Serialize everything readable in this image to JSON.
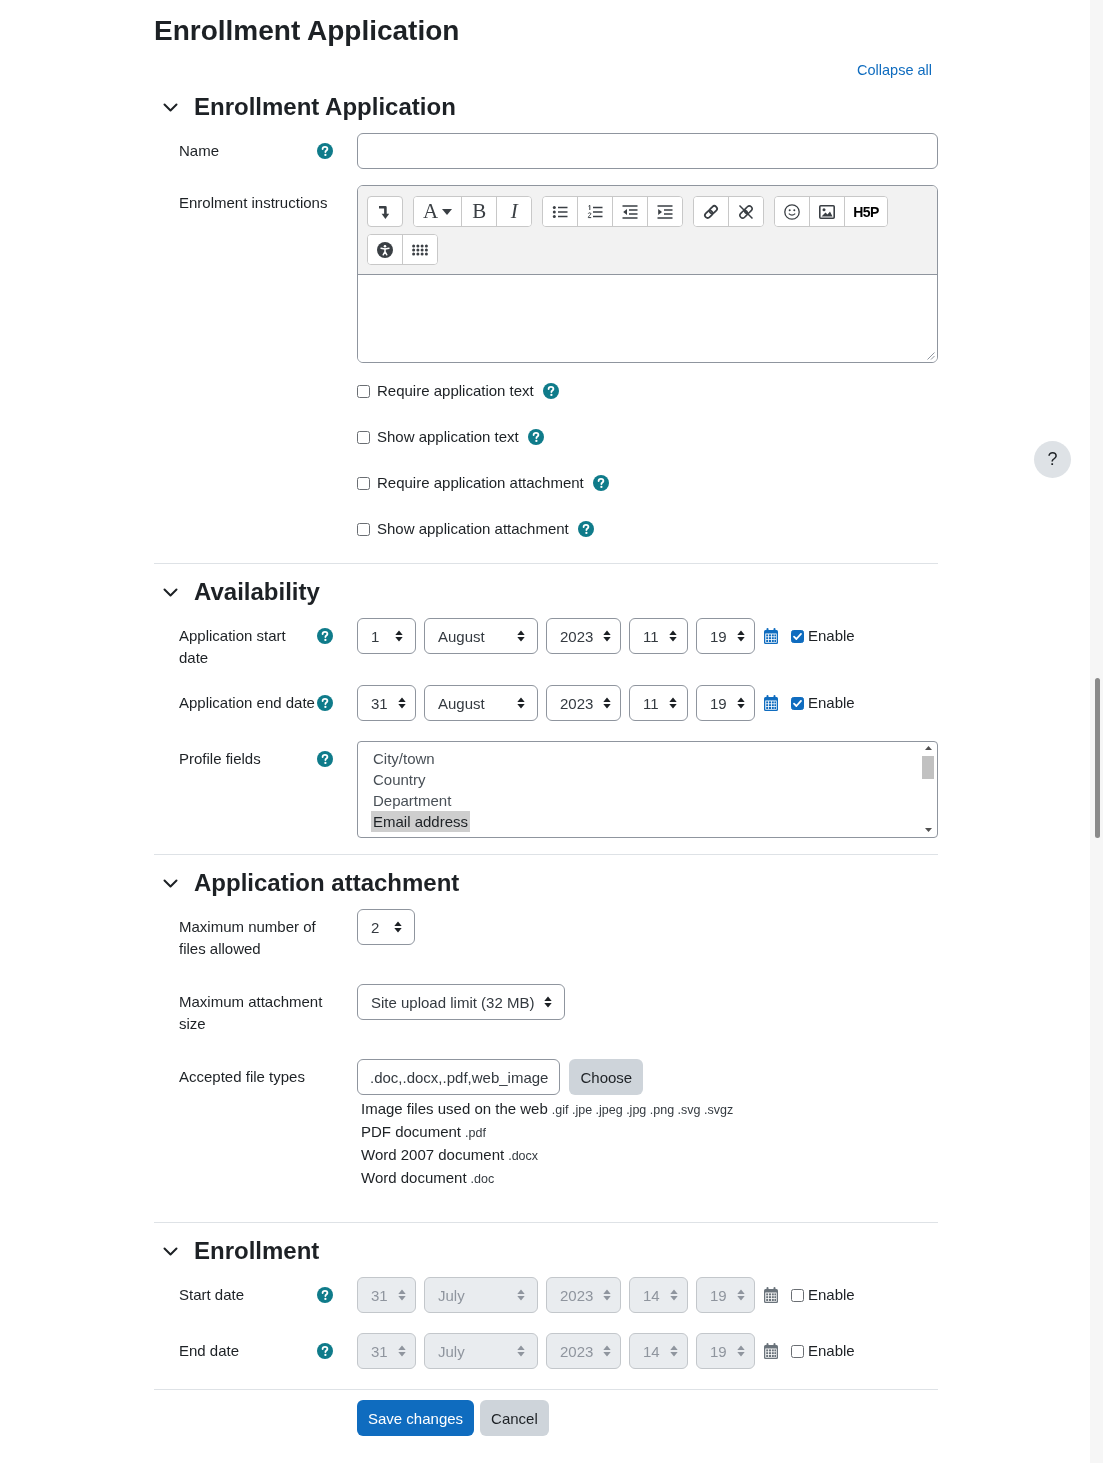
{
  "page_title": "Enrollment Application",
  "collapse_link": "Collapse all",
  "sections": [
    {
      "title": "Enrollment Application",
      "expanded": true,
      "rows": [
        {
          "kind": "text",
          "label": "Name",
          "help": true
        },
        {
          "kind": "editor",
          "label": "Enrolment instructions",
          "help": false,
          "toolbar": [
            [
              [
                {
                  "kind": "icon"
                }
              ],
              [
                {
                  "kind": "menu",
                  "label": "A"
                },
                {
                  "kind": "bold",
                  "label": "B"
                },
                {
                  "kind": "italic",
                  "label": "I"
                }
              ],
              [
                {
                  "kind": "icon"
                },
                {
                  "kind": "icon"
                },
                {
                  "kind": "icon"
                },
                {
                  "kind": "icon"
                }
              ],
              [
                {
                  "kind": "icon"
                },
                {
                  "kind": "icon"
                }
              ],
              [
                {
                  "kind": "icon"
                },
                {
                  "kind": "icon"
                },
                {
                  "kind": "logo",
                  "label": "H5P"
                }
              ]
            ],
            [
              [
                {
                  "kind": "icon"
                },
                {
                  "kind": "icon"
                }
              ]
            ]
          ]
        },
        {
          "kind": "checkbox",
          "label": "Require application text",
          "checked": false,
          "help": true
        },
        {
          "kind": "checkbox",
          "label": "Show application text",
          "checked": false,
          "help": true
        },
        {
          "kind": "checkbox",
          "label": "Require application attachment",
          "checked": false,
          "help": true
        },
        {
          "kind": "checkbox",
          "label": "Show application attachment",
          "checked": false,
          "help": true
        }
      ]
    },
    {
      "title": "Availability",
      "expanded": true,
      "rows": [
        {
          "kind": "date",
          "label": "Application start date",
          "help": true,
          "parts": [
            "1",
            "August",
            "2023",
            "11",
            "19"
          ],
          "enable_label": "Enable",
          "enabled": true
        },
        {
          "kind": "date",
          "label": "Application end date",
          "help": true,
          "parts": [
            "31",
            "August",
            "2023",
            "11",
            "19"
          ],
          "enable_label": "Enable",
          "enabled": true
        },
        {
          "kind": "listbox",
          "label": "Profile fields",
          "help": true,
          "options": [
            {
              "label": "City/town",
              "selected": false
            },
            {
              "label": "Country",
              "selected": false
            },
            {
              "label": "Department",
              "selected": false
            },
            {
              "label": "Email address",
              "selected": true
            }
          ]
        }
      ]
    },
    {
      "title": "Application attachment",
      "expanded": true,
      "rows": [
        {
          "kind": "select",
          "label": "Maximum number of files allowed",
          "help": false,
          "value": "2"
        },
        {
          "kind": "select",
          "label": "Maximum attachment size",
          "help": false,
          "value": "Site upload limit (32 MB)"
        },
        {
          "kind": "filetypes",
          "label": "Accepted file types",
          "help": false,
          "value": ".doc,.docx,.pdf,web_image",
          "button": "Choose",
          "types": [
            {
              "name": "Image files used on the web",
              "extensions": ".gif .jpe .jpeg .jpg .png .svg .svgz"
            },
            {
              "name": "PDF document",
              "extensions": ".pdf"
            },
            {
              "name": "Word 2007 document",
              "extensions": ".docx"
            },
            {
              "name": "Word document",
              "extensions": ".doc"
            }
          ]
        }
      ]
    },
    {
      "title": "Enrollment",
      "expanded": true,
      "rows": [
        {
          "kind": "date",
          "label": "Start date",
          "help": true,
          "parts": [
            "31",
            "July",
            "2023",
            "14",
            "19"
          ],
          "enable_label": "Enable",
          "enabled": false
        },
        {
          "kind": "date",
          "label": "End date",
          "help": true,
          "parts": [
            "31",
            "July",
            "2023",
            "14",
            "19"
          ],
          "enable_label": "Enable",
          "enabled": false
        }
      ]
    }
  ],
  "buttons": [
    {
      "label": "Save changes",
      "kind": "primary"
    },
    {
      "label": "Cancel",
      "kind": "secondary"
    }
  ],
  "help_button": {
    "label": "?"
  }
}
